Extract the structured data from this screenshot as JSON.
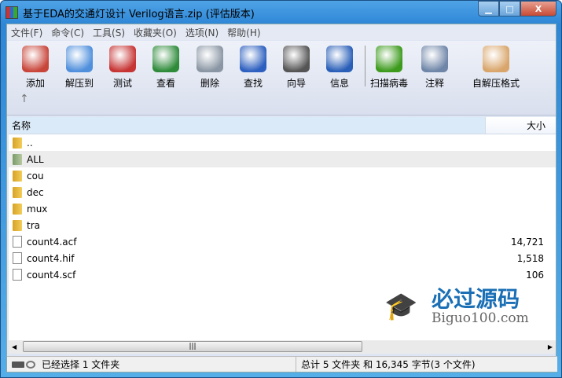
{
  "window": {
    "title": "基于EDA的交通灯设计 Verilog语言.zip (评估版本)",
    "minimize": "▁",
    "maximize": "□",
    "close": "X"
  },
  "menu": [
    "文件(F)",
    "命令(C)",
    "工具(S)",
    "收藏夹(O)",
    "选项(N)",
    "帮助(H)"
  ],
  "toolbar": [
    {
      "label": "添加",
      "icon": "add-archive-icon",
      "color": "#c8453a"
    },
    {
      "label": "解压到",
      "icon": "extract-folder-icon",
      "color": "#4f8fdc"
    },
    {
      "label": "测试",
      "icon": "test-clipboard-icon",
      "color": "#c73434"
    },
    {
      "label": "查看",
      "icon": "view-book-icon",
      "color": "#2e8b3a"
    },
    {
      "label": "删除",
      "icon": "trash-icon",
      "color": "#8a96a4"
    },
    {
      "label": "查找",
      "icon": "search-magnifier-icon",
      "color": "#2c5fbf"
    },
    {
      "label": "向导",
      "icon": "wizard-wand-icon",
      "color": "#555555"
    },
    {
      "label": "信息",
      "icon": "info-icon",
      "color": "#2a5fb8"
    },
    {
      "label": "扫描病毒",
      "icon": "virus-scan-icon",
      "color": "#3c9a1c"
    },
    {
      "label": "注释",
      "icon": "comment-icon",
      "color": "#6f86a8"
    },
    {
      "label": "自解压格式",
      "icon": "sfx-box-icon",
      "color": "#d9a56a"
    }
  ],
  "up_arrow": "↑",
  "columns": {
    "name": "名称",
    "size": "大小"
  },
  "files": [
    {
      "name": "..",
      "type": "folder",
      "size": ""
    },
    {
      "name": "ALL",
      "type": "folder",
      "size": "",
      "selected": true
    },
    {
      "name": "cou",
      "type": "folder",
      "size": ""
    },
    {
      "name": "dec",
      "type": "folder",
      "size": ""
    },
    {
      "name": "mux",
      "type": "folder",
      "size": ""
    },
    {
      "name": "tra",
      "type": "folder",
      "size": ""
    },
    {
      "name": "count4.acf",
      "type": "file",
      "size": "14,721"
    },
    {
      "name": "count4.hif",
      "type": "file",
      "size": "1,518"
    },
    {
      "name": "count4.scf",
      "type": "file",
      "size": "106"
    }
  ],
  "status": {
    "selected": "已经选择 1 文件夹",
    "total": "总计 5 文件夹 和 16,345 字节(3 个文件)"
  },
  "watermark": {
    "cn": "必过源码",
    "en": "Biguo100.com"
  }
}
